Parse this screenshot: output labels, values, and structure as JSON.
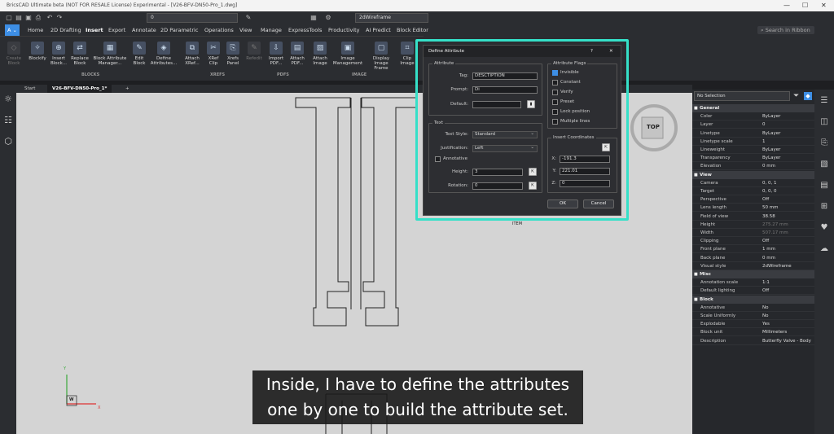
{
  "window": {
    "title": "BricsCAD Ultimate beta (NOT FOR RESALE License) Experimental - [V26-BFV-DN50-Pro_1.dwg]",
    "minimize": "—",
    "maximize": "☐",
    "close": "✕"
  },
  "qat": {
    "layer_value": "0",
    "visual_style": "2dWireframe"
  },
  "menu_tabs": [
    {
      "label": "Home"
    },
    {
      "label": "2D Drafting"
    },
    {
      "label": "Insert"
    },
    {
      "label": "Export"
    },
    {
      "label": "Annotate"
    },
    {
      "label": "2D Parametric"
    },
    {
      "label": "Operations"
    },
    {
      "label": "View"
    },
    {
      "label": "Manage"
    },
    {
      "label": "ExpressTools"
    },
    {
      "label": "Productivity"
    },
    {
      "label": "AI Predict"
    },
    {
      "label": "Block Editor"
    }
  ],
  "search_ribbon": "Search in Ribbon",
  "ribbon": {
    "buttons": [
      {
        "label": "Create Block",
        "icon": "create-block-icon"
      },
      {
        "label": "Blockify",
        "icon": "blockify-icon"
      },
      {
        "label": "Insert Block...",
        "icon": "insert-block-icon"
      },
      {
        "label": "Replace Block",
        "icon": "replace-block-icon"
      },
      {
        "label": "Block Attribute Manager...",
        "icon": "block-attribute-manager-icon"
      },
      {
        "label": "Edit Block",
        "icon": "edit-block-icon"
      },
      {
        "label": "Define Attributes...",
        "icon": "define-attributes-icon"
      },
      {
        "label": "Attach XRef...",
        "icon": "attach-xref-icon"
      },
      {
        "label": "XRef Clip",
        "icon": "xref-clip-icon"
      },
      {
        "label": "Xrefs Panel",
        "icon": "xrefs-panel-icon"
      },
      {
        "label": "Refedit",
        "icon": "refedit-icon"
      },
      {
        "label": "Import PDF...",
        "icon": "import-pdf-icon"
      },
      {
        "label": "Attach PDF...",
        "icon": "attach-pdf-icon"
      },
      {
        "label": "Attach Image",
        "icon": "attach-image-icon"
      },
      {
        "label": "Image Management",
        "icon": "image-management-icon"
      },
      {
        "label": "Display Image Frame",
        "icon": "display-image-frame-icon"
      },
      {
        "label": "Clip Image",
        "icon": "clip-image-icon"
      }
    ],
    "groups": [
      "BLOCKS",
      "XREFS",
      "PDFS",
      "IMAGE"
    ]
  },
  "doc_tabs": [
    {
      "label": "Start"
    },
    {
      "label": "V26-BFV-DN50-Pro_1*"
    },
    {
      "label": "+"
    }
  ],
  "canvas": {
    "item_text": "ITEM",
    "viewcube_label": "TOP",
    "ucs_x": "X",
    "ucs_y": "Y",
    "ucs_w": "W"
  },
  "dialog": {
    "title": "Define Attribute",
    "help": "?",
    "close": "✕",
    "attribute_section": "Attribute",
    "tag_label": "Tag:",
    "tag_value": "DESCTIPTION",
    "prompt_label": "Prompt:",
    "prompt_value": "Di",
    "default_label": "Default:",
    "default_value": "",
    "text_section": "Text",
    "text_style_label": "Text Style:",
    "text_style_value": "Standard",
    "justification_label": "Justification:",
    "justification_value": "Left",
    "annotative_label": "Annotative",
    "height_label": "Height:",
    "height_value": "3",
    "rotation_label": "Rotation:",
    "rotation_value": "0",
    "flags_section": "Attribute Flags",
    "flags": [
      {
        "label": "Invisible",
        "checked": true
      },
      {
        "label": "Constant",
        "checked": false
      },
      {
        "label": "Verify",
        "checked": false
      },
      {
        "label": "Preset",
        "checked": false
      },
      {
        "label": "Lock position",
        "checked": false
      },
      {
        "label": "Multiple lines",
        "checked": false
      }
    ],
    "insert_section": "Insert Coordinates",
    "x_label": "X:",
    "x_value": "-191.3",
    "y_label": "Y:",
    "y_value": "221.01",
    "z_label": "Z:",
    "z_value": "0",
    "ok": "OK",
    "cancel": "Cancel"
  },
  "properties": {
    "selection": "No Selection",
    "sections": [
      {
        "name": "General",
        "rows": [
          [
            "Color",
            "ByLayer"
          ],
          [
            "Layer",
            "0"
          ],
          [
            "Linetype",
            "ByLayer"
          ],
          [
            "Linetype scale",
            "1"
          ],
          [
            "Lineweight",
            "ByLayer"
          ],
          [
            "Transparency",
            "ByLayer"
          ],
          [
            "Elevation",
            "0 mm"
          ]
        ]
      },
      {
        "name": "View",
        "rows": [
          [
            "Camera",
            "0, 0, 1"
          ],
          [
            "Target",
            "0, 0, 0"
          ],
          [
            "Perspective",
            "Off"
          ],
          [
            "Lens length",
            "50 mm"
          ],
          [
            "Field of view",
            "38.58"
          ],
          [
            "Height",
            "275.27 mm"
          ],
          [
            "Width",
            "507.17 mm"
          ],
          [
            "Clipping",
            "Off"
          ],
          [
            "Front plane",
            "1 mm"
          ],
          [
            "Back plane",
            "0 mm"
          ],
          [
            "Visual style",
            "2dWireframe"
          ]
        ]
      },
      {
        "name": "Misc",
        "rows": [
          [
            "Annotation scale",
            "1:1"
          ],
          [
            "Default lighting",
            "Off"
          ]
        ]
      },
      {
        "name": "Block",
        "rows": [
          [
            "Annotative",
            "No"
          ],
          [
            "Scale Uniformly",
            "No"
          ],
          [
            "Explodable",
            "Yes"
          ],
          [
            "Block unit",
            "Millimeters"
          ],
          [
            "Description",
            "Butterfly Valve - Body"
          ]
        ]
      }
    ]
  },
  "caption": {
    "line1": "Inside, I have to define the attributes",
    "line2": "one by one to build the attribute set."
  },
  "colors": {
    "accent": "#3d8ee5",
    "highlight": "#35e0c8",
    "canvas": "#d4d4d4"
  }
}
